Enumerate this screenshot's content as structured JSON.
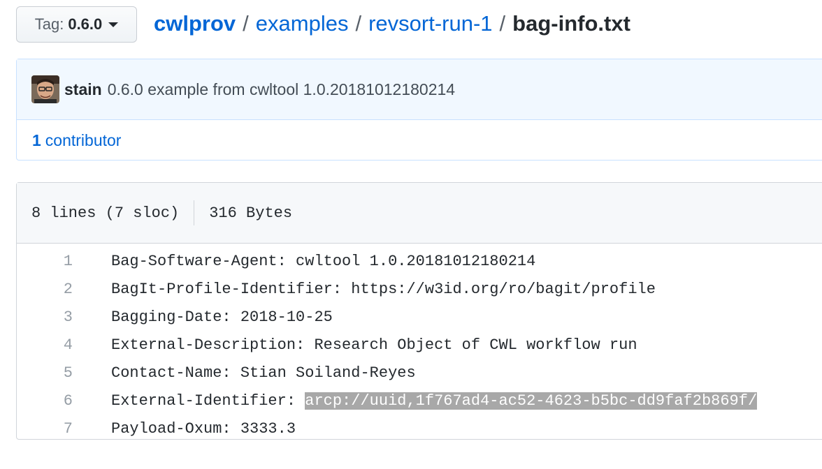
{
  "tag": {
    "prefix": "Tag:",
    "value": "0.6.0"
  },
  "breadcrumb": {
    "repo": "cwlprov",
    "separator": "/",
    "dir1": "examples",
    "dir2": "revsort-run-1",
    "file": "bag-info.txt"
  },
  "commit": {
    "author": "stain",
    "message": "0.6.0 example from cwltool 1.0.20181012180214"
  },
  "contributors": {
    "count": "1",
    "label": "contributor"
  },
  "file_info": {
    "lines": "8 lines (7 sloc)",
    "size": "316 Bytes"
  },
  "code_lines": [
    {
      "num": "1",
      "text": "Bag-Software-Agent: cwltool 1.0.20181012180214"
    },
    {
      "num": "2",
      "text": "BagIt-Profile-Identifier: https://w3id.org/ro/bagit/profile"
    },
    {
      "num": "3",
      "text": "Bagging-Date: 2018-10-25"
    },
    {
      "num": "4",
      "text": "External-Description: Research Object of CWL workflow run"
    },
    {
      "num": "5",
      "text": "Contact-Name: Stian Soiland-Reyes"
    },
    {
      "num": "6",
      "text": "External-Identifier: ",
      "highlight": "arcp://uuid,1f767ad4-ac52-4623-b5bc-dd9faf2b869f/"
    },
    {
      "num": "7",
      "text": "Payload-Oxum: 3333.3"
    }
  ],
  "colors": {
    "link": "#0366d6",
    "commit_bg": "#f1f8ff",
    "commit_border": "#c8e1ff",
    "selection": "#a8a8a8"
  },
  "icons": {
    "caret": "caret-down-icon",
    "avatar": "avatar"
  }
}
